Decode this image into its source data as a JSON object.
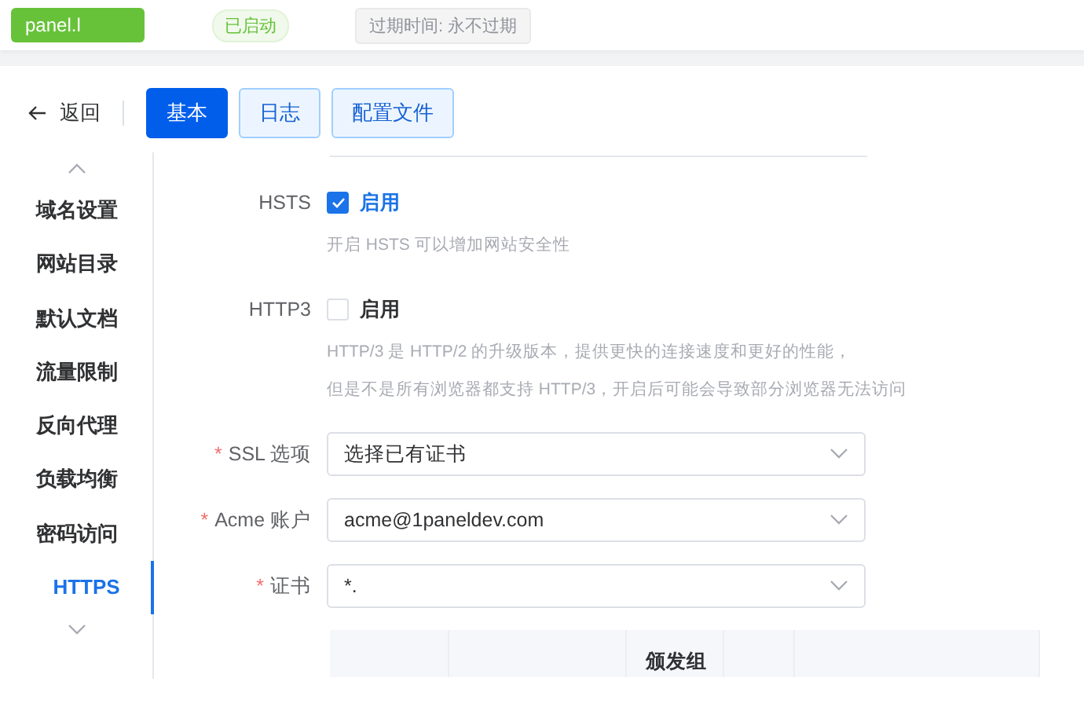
{
  "header": {
    "site_name": "panel.l",
    "status": "已启动",
    "expiry": "过期时间: 永不过期"
  },
  "toolbar": {
    "back": "返回",
    "tabs": [
      {
        "label": "基本",
        "selected": true
      },
      {
        "label": "日志",
        "selected": false
      },
      {
        "label": "配置文件",
        "selected": false
      }
    ]
  },
  "sidebar": {
    "items": [
      {
        "label": "域名设置",
        "selected": false
      },
      {
        "label": "网站目录",
        "selected": false
      },
      {
        "label": "默认文档",
        "selected": false
      },
      {
        "label": "流量限制",
        "selected": false
      },
      {
        "label": "反向代理",
        "selected": false
      },
      {
        "label": "负载均衡",
        "selected": false
      },
      {
        "label": "密码访问",
        "selected": false
      },
      {
        "label": "HTTPS",
        "selected": true
      }
    ]
  },
  "form": {
    "fields": [
      {
        "kind": "checkbox",
        "label": "HSTS",
        "option": "启用",
        "checked": true,
        "hints": [
          "开启 HSTS 可以增加网站安全性"
        ]
      },
      {
        "kind": "checkbox",
        "label": "HTTP3",
        "option": "启用",
        "checked": false,
        "hints": [
          "HTTP/3 是 HTTP/2 的升级版本，提供更快的连接速度和更好的性能，",
          "但是不是所有浏览器都支持 HTTP/3，开启后可能会导致部分浏览器无法访问"
        ]
      },
      {
        "kind": "select",
        "label": "SSL 选项",
        "required_mark": "*",
        "value": "选择已有证书"
      },
      {
        "kind": "select",
        "label": "Acme 账户",
        "required_mark": "*",
        "value": "acme@1paneldev.com"
      },
      {
        "kind": "select",
        "label": "证书",
        "required_mark": "*",
        "value": "*."
      }
    ]
  },
  "table": {
    "columns": [
      {},
      {},
      {
        "title": "颁发组"
      },
      {},
      {}
    ]
  }
}
